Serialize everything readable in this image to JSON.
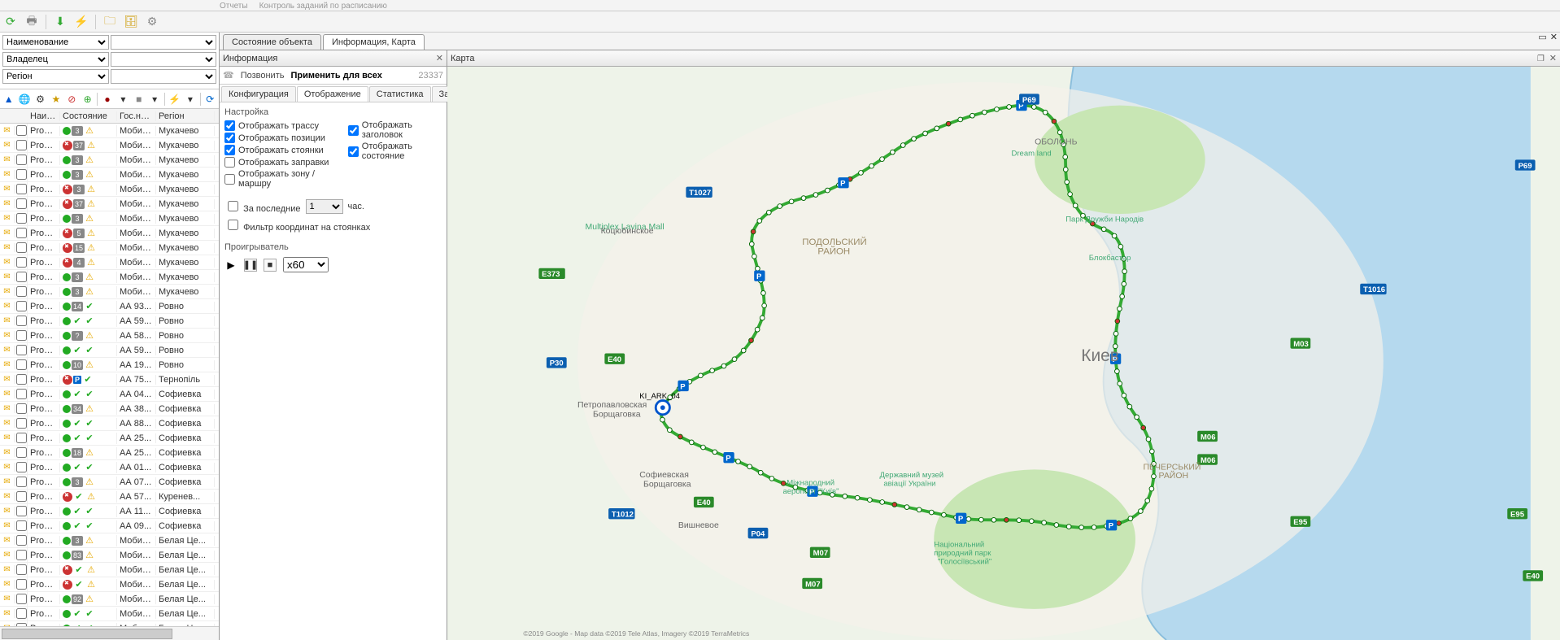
{
  "top_menu": {
    "items": [
      "Отчеты",
      "Контроль заданий по расписанию"
    ]
  },
  "toolbar": {
    "icons": [
      "refresh",
      "print",
      "download",
      "flash",
      "folder",
      "db",
      "settings"
    ]
  },
  "filters": {
    "name_label": "Наименование",
    "name_value": "",
    "owner_label": "Владелец",
    "owner_value": "",
    "region_label": "Регіон",
    "region_value": ""
  },
  "mini_toolbar": {
    "icons": [
      "triangle",
      "globe",
      "gear",
      "star",
      "circle-red",
      "circle-green",
      "sep",
      "square",
      "triangle-down",
      "sep",
      "flash",
      "triangle-down",
      "sep",
      "refresh"
    ]
  },
  "grid": {
    "columns": {
      "idx": "",
      "name": "Наимен...",
      "state": "Состояние",
      "gos": "Гос.но...",
      "region": "Регіон"
    },
    "rows": [
      {
        "name": "ProdM...",
        "state": {
          "dot": "green",
          "badge": "3",
          "extra": "warn"
        },
        "gos": "Мобил...",
        "region": "Мукачево"
      },
      {
        "name": "ProdM...",
        "state": {
          "dot": "red",
          "badge": "37",
          "extra": "warn"
        },
        "gos": "Мобил...",
        "region": "Мукачево"
      },
      {
        "name": "ProdM...",
        "state": {
          "dot": "green",
          "badge": "3",
          "extra": "warn"
        },
        "gos": "Мобил...",
        "region": "Мукачево"
      },
      {
        "name": "ProdM...",
        "state": {
          "dot": "green",
          "badge": "3",
          "extra": "warn"
        },
        "gos": "Мобил...",
        "region": "Мукачево"
      },
      {
        "name": "ProdM...",
        "state": {
          "dot": "red",
          "badge": "3",
          "extra": "warn"
        },
        "gos": "Мобил...",
        "region": "Мукачево"
      },
      {
        "name": "ProdM...",
        "state": {
          "dot": "red",
          "badge": "37",
          "extra": "warn"
        },
        "gos": "Мобил...",
        "region": "Мукачево"
      },
      {
        "name": "ProdM...",
        "state": {
          "dot": "green",
          "badge": "3",
          "extra": "warn"
        },
        "gos": "Мобил...",
        "region": "Мукачево"
      },
      {
        "name": "ProdM...",
        "state": {
          "dot": "red",
          "badge": "5",
          "extra": "warn"
        },
        "gos": "Мобил...",
        "region": "Мукачево"
      },
      {
        "name": "ProdM...",
        "state": {
          "dot": "red",
          "badge": "15",
          "extra": "warn"
        },
        "gos": "Мобил...",
        "region": "Мукачево"
      },
      {
        "name": "ProdM...",
        "state": {
          "dot": "red",
          "badge": "4",
          "extra": "warn"
        },
        "gos": "Мобил...",
        "region": "Мукачево"
      },
      {
        "name": "ProdM...",
        "state": {
          "dot": "green",
          "badge": "3",
          "extra": "warn"
        },
        "gos": "Мобил...",
        "region": "Мукачево"
      },
      {
        "name": "ProdM...",
        "state": {
          "dot": "green",
          "badge": "3",
          "extra": "warn"
        },
        "gos": "Мобил...",
        "region": "Мукачево"
      },
      {
        "name": "ProdM...",
        "state": {
          "dot": "green",
          "badge": "14",
          "extra": "ok"
        },
        "gos": "АА 93...",
        "region": "Ровно"
      },
      {
        "name": "ProdM...",
        "state": {
          "dot": "green",
          "badge": "",
          "extra": "ok"
        },
        "gos": "АА 59...",
        "region": "Ровно"
      },
      {
        "name": "ProdM...",
        "state": {
          "dot": "green",
          "badge": "?",
          "extra": "warn"
        },
        "gos": "АА 58...",
        "region": "Ровно"
      },
      {
        "name": "ProdM...",
        "state": {
          "dot": "green",
          "badge": "",
          "extra": "ok"
        },
        "gos": "АА 59...",
        "region": "Ровно"
      },
      {
        "name": "ProdM...",
        "state": {
          "dot": "green",
          "badge": "10",
          "extra": "warn"
        },
        "gos": "АА 19...",
        "region": "Ровно"
      },
      {
        "name": "ProdM...",
        "state": {
          "dot": "red",
          "badge": "P",
          "extra": "ok",
          "park": true
        },
        "gos": "АА 75...",
        "region": "Тернопіль"
      },
      {
        "name": "ProdM...",
        "state": {
          "dot": "green",
          "badge": "",
          "extra": "ok"
        },
        "gos": "АА 04...",
        "region": "Софиевка"
      },
      {
        "name": "ProdM...",
        "state": {
          "dot": "green",
          "badge": "34",
          "extra": "warn"
        },
        "gos": "АА 38...",
        "region": "Софиевка"
      },
      {
        "name": "ProdM...",
        "state": {
          "dot": "green",
          "badge": "",
          "extra": "ok"
        },
        "gos": "АА 88...",
        "region": "Софиевка"
      },
      {
        "name": "ProdM...",
        "state": {
          "dot": "green",
          "badge": "",
          "extra": "ok"
        },
        "gos": "АА 25...",
        "region": "Софиевка"
      },
      {
        "name": "ProdM...",
        "state": {
          "dot": "green",
          "badge": "18",
          "extra": "warn"
        },
        "gos": "АА 25...",
        "region": "Софиевка"
      },
      {
        "name": "ProdM...",
        "state": {
          "dot": "green",
          "badge": "",
          "extra": "ok"
        },
        "gos": "АА 01...",
        "region": "Софиевка"
      },
      {
        "name": "ProdM...",
        "state": {
          "dot": "green",
          "badge": "3",
          "extra": "warn"
        },
        "gos": "АА 07...",
        "region": "Софиевка"
      },
      {
        "name": "ProdM...",
        "state": {
          "dot": "red",
          "badge": "",
          "extra": "warn"
        },
        "gos": "АА 57...",
        "region": "Куренев..."
      },
      {
        "name": "ProdM...",
        "state": {
          "dot": "green",
          "badge": "",
          "extra": "ok"
        },
        "gos": "АА 11...",
        "region": "Софиевка"
      },
      {
        "name": "ProdM...",
        "state": {
          "dot": "green",
          "badge": "",
          "extra": "ok"
        },
        "gos": "АА 09...",
        "region": "Софиевка"
      },
      {
        "name": "ProdM...",
        "state": {
          "dot": "green",
          "badge": "3",
          "extra": "warn"
        },
        "gos": "Мобил...",
        "region": "Белая Це..."
      },
      {
        "name": "ProdM...",
        "state": {
          "dot": "green",
          "badge": "83",
          "extra": "warn"
        },
        "gos": "Мобил...",
        "region": "Белая Це..."
      },
      {
        "name": "ProdM...",
        "state": {
          "dot": "red",
          "badge": "",
          "extra": "warn"
        },
        "gos": "Мобил...",
        "region": "Белая Це..."
      },
      {
        "name": "ProdM...",
        "state": {
          "dot": "red",
          "badge": "",
          "extra": "warn"
        },
        "gos": "Мобил...",
        "region": "Белая Це..."
      },
      {
        "name": "ProdM...",
        "state": {
          "dot": "green",
          "badge": "92",
          "extra": "warn"
        },
        "gos": "Мобил...",
        "region": "Белая Це..."
      },
      {
        "name": "ProdM...",
        "state": {
          "dot": "green",
          "badge": "",
          "extra": "ok"
        },
        "gos": "Мобил...",
        "region": "Белая Це..."
      },
      {
        "name": "ProdM...",
        "state": {
          "dot": "green",
          "badge": "",
          "extra": "ok"
        },
        "gos": "Мобил...",
        "region": "Белая Це..."
      }
    ]
  },
  "right_tabs": {
    "tabs": [
      "Состояние объекта",
      "Информация, Карта"
    ],
    "active": 1
  },
  "info": {
    "title": "Информация",
    "call": "Позвонить",
    "apply_all": "Применить для всех",
    "id": "23337",
    "tabs": [
      "Конфигурация",
      "Отображение",
      "Статистика",
      "Задания"
    ],
    "active": 1,
    "section": "Настройка",
    "opts_left": [
      {
        "label": "Отображать трассу",
        "checked": true
      },
      {
        "label": "Отображать позиции",
        "checked": true
      },
      {
        "label": "Отображать стоянки",
        "checked": true
      },
      {
        "label": "Отображать заправки",
        "checked": false
      },
      {
        "label": "Отображать зону / маршру",
        "checked": false
      }
    ],
    "opts_right": [
      {
        "label": "Отображать заголовок",
        "checked": true
      },
      {
        "label": "Отображать состояние",
        "checked": true
      }
    ],
    "last": "За последние",
    "last_val": "1",
    "last_unit": "час.",
    "filter_coord": "Фильтр координат на стоянках",
    "filter_coord_checked": false,
    "player_title": "Проигрыватель",
    "speed": "x60"
  },
  "map": {
    "title": "Карта",
    "attribution": "©2019 Google - Map data ©2019 Tele Atlas, Imagery ©2019 TerraMetrics",
    "labels": {
      "kiev": "Киев",
      "podol": "ПОДОЛЬСКИЙ\nРАЙОН",
      "pecher": "ПЕЧЕРСЬКИЙ\nРАЙОН",
      "obolon": "ОБОЛОНЬ",
      "lavina": "Multiplex Lavina Mall",
      "petro": "Петропавловская\nБорщаговка",
      "sofb": "Софиевская\nБорщаговка",
      "vish": "Вишневое",
      "kocub": "Коцюбинское",
      "airport": "Міжнародний\nаеропорт \"Київ\"",
      "museum": "Державний музей\nавіації України",
      "holos": "Національний\nприродний парк\n\"Голосіївський\"",
      "druzhby": "Парк Дружби Народів",
      "block": "Блокбастер",
      "dream": "Dream land",
      "marker": "KI_ARK_04"
    },
    "roads": [
      "P69",
      "T1027",
      "E373",
      "P30",
      "E40",
      "E40",
      "T1012",
      "P04",
      "M07",
      "M07",
      "M06",
      "M06",
      "E95",
      "E95",
      "E40",
      "T1016",
      "M03",
      "P69"
    ]
  }
}
